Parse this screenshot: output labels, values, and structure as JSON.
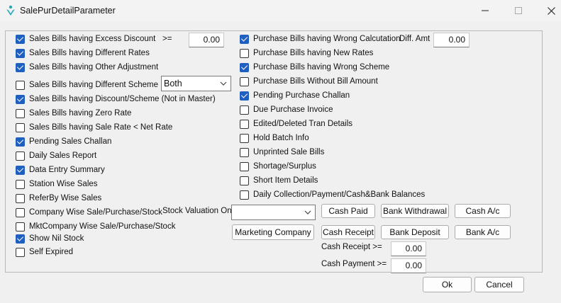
{
  "window": {
    "title": "SalePurDetailParameter"
  },
  "left_options": [
    {
      "label": "Sales Bills having Excess Discount",
      "checked": true
    },
    {
      "label": "Sales Bills having Different Rates",
      "checked": true
    },
    {
      "label": "Sales Bills having Other Adjustment",
      "checked": true
    },
    {
      "label": "Sales Bills having Different Scheme",
      "checked": false
    },
    {
      "label": "Sales Bills having Discount/Scheme (Not in Master)",
      "checked": true
    },
    {
      "label": "Sales Bills having Zero Rate",
      "checked": false
    },
    {
      "label": "Sales Bills having Sale Rate < Net Rate",
      "checked": false
    },
    {
      "label": "Pending Sales Challan",
      "checked": true
    },
    {
      "label": "Daily Sales Report",
      "checked": false
    },
    {
      "label": "Data Entry Summary",
      "checked": true
    },
    {
      "label": "Station Wise Sales",
      "checked": false
    },
    {
      "label": "ReferBy Wise Sales",
      "checked": false
    },
    {
      "label": "Company Wise Sale/Purchase/Stock",
      "checked": false
    },
    {
      "label": "MktCompany Wise Sale/Purchase/Stock",
      "checked": false
    },
    {
      "label": "Show Nil Stock",
      "checked": true
    },
    {
      "label": "Self Expired",
      "checked": false
    }
  ],
  "right_options": [
    {
      "label": "Purchase Bills having Wrong Calcutation",
      "checked": true
    },
    {
      "label": "Purchase Bills having New Rates",
      "checked": false
    },
    {
      "label": "Purchase Bills having Wrong Scheme",
      "checked": true
    },
    {
      "label": "Purchase Bills Without Bill Amount",
      "checked": false
    },
    {
      "label": "Pending Purchase Challan",
      "checked": true
    },
    {
      "label": "Due Purchase Invoice",
      "checked": false
    },
    {
      "label": "Edited/Deleted Tran Details",
      "checked": false
    },
    {
      "label": "Hold Batch Info",
      "checked": false
    },
    {
      "label": "Unprinted Sale Bills",
      "checked": false
    },
    {
      "label": "Shortage/Surplus",
      "checked": false
    },
    {
      "label": "Short Item Details",
      "checked": false
    },
    {
      "label": "Daily Collection/Payment/Cash&Bank Balances",
      "checked": false
    }
  ],
  "excess_discount": {
    "operator": ">=",
    "value": "0.00"
  },
  "diff_amt": {
    "label": "Diff. Amt",
    "value": "0.00"
  },
  "scheme_combo": {
    "value": "Both"
  },
  "stock_valuation": {
    "label": "Stock Valuation On",
    "value": ""
  },
  "buttons": {
    "cash_paid": "Cash Paid",
    "bank_withdrawal": "Bank Withdrawal",
    "cash_ac": "Cash A/c",
    "marketing_company": "Marketing Company",
    "cash_receipt": "Cash Receipt",
    "bank_deposit": "Bank Deposit",
    "bank_ac": "Bank A/c",
    "ok": "Ok",
    "cancel": "Cancel"
  },
  "cash_receipt_filter": {
    "label": "Cash Receipt >=",
    "value": "0.00"
  },
  "cash_payment_filter": {
    "label": "Cash Payment >=",
    "value": "0.00"
  },
  "colors": {
    "check_accent": "#1f5fbf",
    "window_bg": "#f0f0f0"
  },
  "icons": {
    "app": "app-logo-icon",
    "minimize": "minimize-icon",
    "maximize": "maximize-icon",
    "close": "close-icon"
  }
}
